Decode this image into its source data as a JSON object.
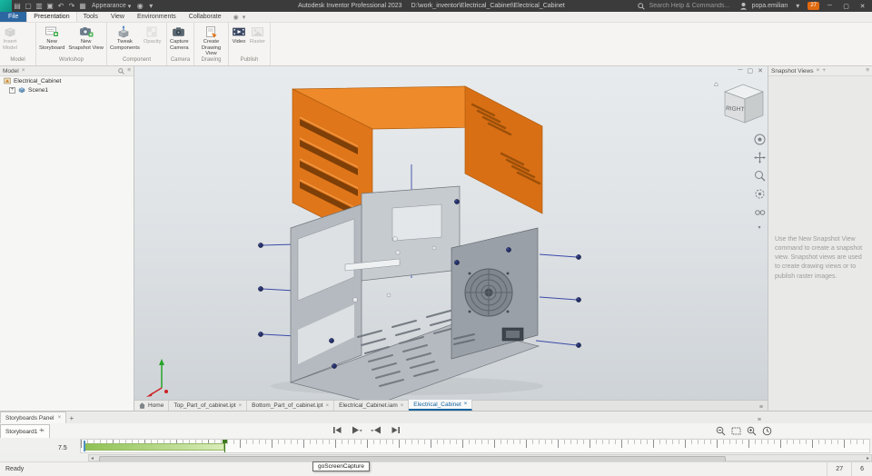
{
  "colors": {
    "accent_blue": "#1464a0",
    "part_orange": "#e0761a",
    "part_gray": "#a9aeb4",
    "trail_blue": "#3a4aa8",
    "timeline_green": "#7cb342"
  },
  "icons": {
    "close": "×",
    "close_strong": "✕",
    "plus": "+",
    "hamburger": "≡",
    "caret_down": "▾",
    "minimize": "─",
    "restore": "▢",
    "home": "⌂",
    "record": "◉",
    "menu_grid": "▤",
    "new_doc": "▢",
    "open_doc": "▥",
    "save": "▣",
    "undo": "↶",
    "redo": "↷",
    "print": "▦",
    "scroll_left": "◂",
    "scroll_right": "▸"
  },
  "titlebar": {
    "app_title": "Autodesk Inventor Professional 2023",
    "doc_path": "D:\\work_inventor\\Electrical_Cabinet\\Electrical_Cabinet",
    "appearance_label": "Appearance",
    "search_placeholder": "Search Help & Commands...",
    "user_name": "popa.emilian",
    "notification_count": "27"
  },
  "ribbon": {
    "active_tab": "Presentation",
    "tabs": [
      {
        "label": "File"
      },
      {
        "label": "Presentation"
      },
      {
        "label": "Tools"
      },
      {
        "label": "View"
      },
      {
        "label": "Environments"
      },
      {
        "label": "Collaborate"
      }
    ],
    "groups": [
      {
        "label": "Model"
      },
      {
        "label": "Workshop"
      },
      {
        "label": "Component"
      },
      {
        "label": "Camera"
      },
      {
        "label": "Drawing"
      },
      {
        "label": "Publish"
      }
    ],
    "buttons": {
      "insert_model": {
        "line1": "Insert",
        "line2": "Model"
      },
      "new_storyboard": {
        "line1": "New",
        "line2": "Storyboard"
      },
      "new_snapshot_view": {
        "line1": "New",
        "line2": "Snapshot View"
      },
      "tweak_components": {
        "line1": "Tweak",
        "line2": "Components"
      },
      "opacity": {
        "line1": "Opacity",
        "line2": ""
      },
      "capture_camera": {
        "line1": "Capture",
        "line2": "Camera"
      },
      "create_drawing_view": {
        "line1": "Create",
        "line2": "Drawing View"
      },
      "video": {
        "line1": "Video",
        "line2": ""
      },
      "raster": {
        "line1": "Raster",
        "line2": ""
      }
    }
  },
  "browser": {
    "title": "Model",
    "items": [
      {
        "label": "Electrical_Cabinet"
      },
      {
        "label": "Scene1"
      }
    ]
  },
  "viewport": {
    "viewcube_face": "RIGHT",
    "doc_tabs": [
      {
        "label": "Home"
      },
      {
        "label": "Top_Part_of_cabinet.ipt"
      },
      {
        "label": "Bottom_Part_of_cabinet.ipt"
      },
      {
        "label": "Electrical_Cabinet.iam"
      },
      {
        "label": "Electrical_Cabinet"
      }
    ],
    "active_doc_tab": "Electrical_Cabinet"
  },
  "snapshot_panel": {
    "title": "Snapshot Views",
    "help_text": "Use the New Snapshot View command to create a snapshot view. Snapshot views are used to create drawing views or to publish raster images."
  },
  "storyboard": {
    "panel_label": "Storyboards Panel",
    "storyboard_tab": "Storyboard1",
    "current_time": "7.5"
  },
  "statusbar": {
    "status": "Ready",
    "tooltip": "goScreenCapture",
    "count_a": "27",
    "count_b": "6"
  }
}
